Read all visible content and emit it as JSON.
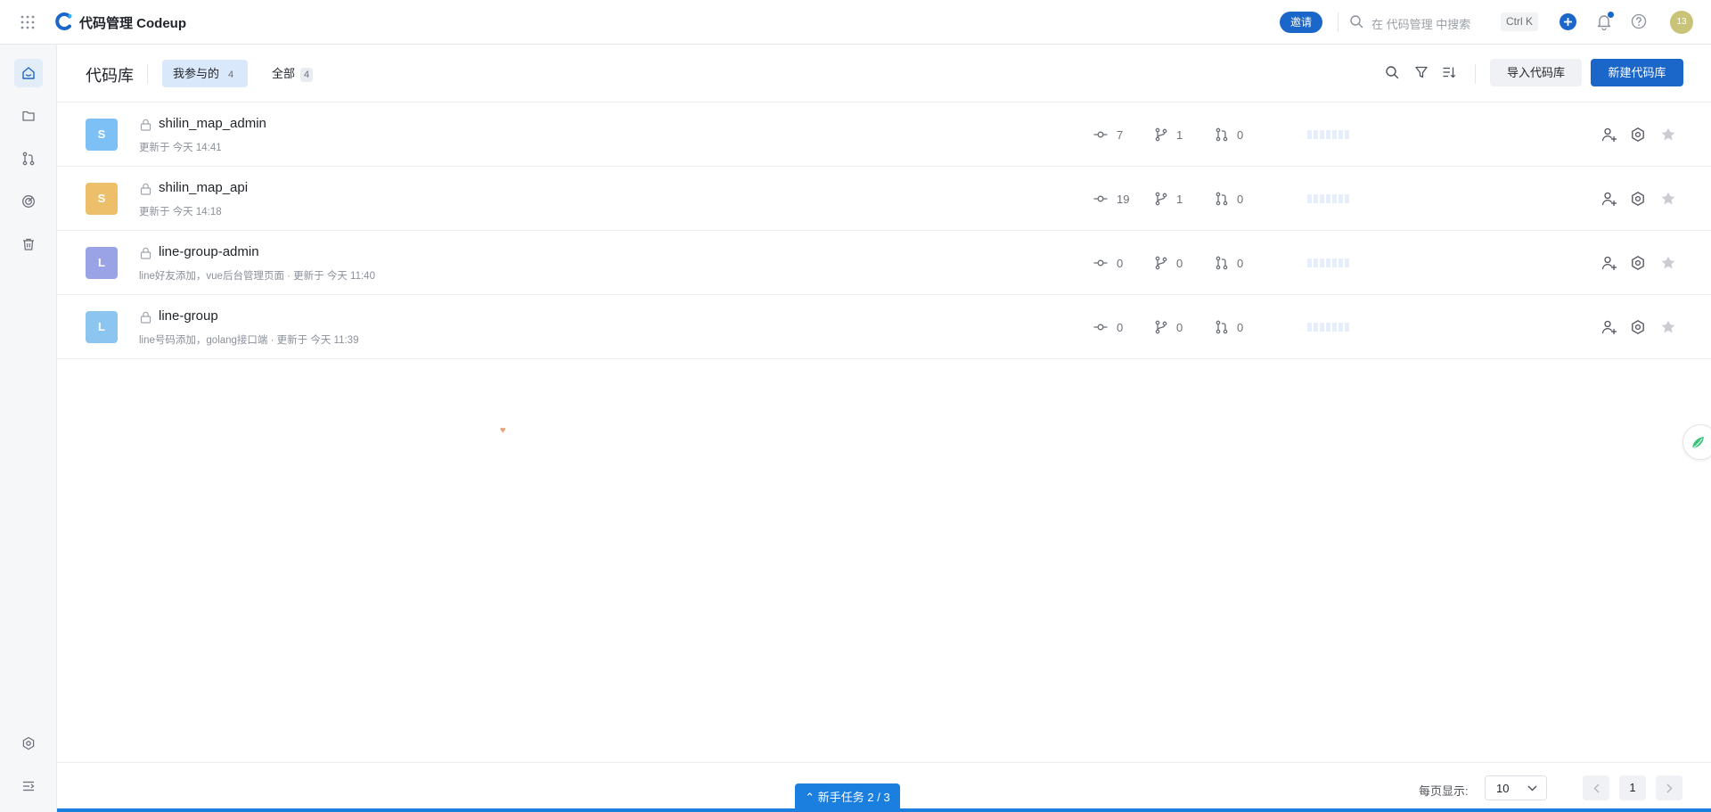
{
  "app": {
    "title": "代码管理 Codeup",
    "invite_label": "邀请",
    "search_placeholder": "在 代码管理 中搜索",
    "search_shortcut": "Ctrl K",
    "user_initials": "13"
  },
  "header": {
    "page_title": "代码库",
    "tabs": [
      {
        "label": "我参与的",
        "count": "4",
        "active": true
      },
      {
        "label": "全部",
        "count": "4",
        "active": false
      }
    ],
    "import_label": "导入代码库",
    "new_label": "新建代码库"
  },
  "repos": [
    {
      "initial": "S",
      "color": "#7cc0f5",
      "name": "shilin_map_admin",
      "meta": "更新于 今天 14:41",
      "commits": "7",
      "branches": "1",
      "merge_requests": "0"
    },
    {
      "initial": "S",
      "color": "#edbf6b",
      "name": "shilin_map_api",
      "meta": "更新于 今天 14:18",
      "commits": "19",
      "branches": "1",
      "merge_requests": "0"
    },
    {
      "initial": "L",
      "color": "#9aa3e6",
      "name": "line-group-admin",
      "meta": "line好友添加，vue后台管理页面 · 更新于 今天 11:40",
      "commits": "0",
      "branches": "0",
      "merge_requests": "0"
    },
    {
      "initial": "L",
      "color": "#8cc6f0",
      "name": "line-group",
      "meta": "line号码添加，golang接口端 · 更新于 今天 11:39",
      "commits": "0",
      "branches": "0",
      "merge_requests": "0"
    }
  ],
  "footer": {
    "page_size_label": "每页显示:",
    "page_size": "10",
    "current_page": "1",
    "guide_label": "新手任务 2 / 3"
  },
  "colors": {
    "accent": "#1b66c9",
    "guide": "#1b7fe0"
  }
}
